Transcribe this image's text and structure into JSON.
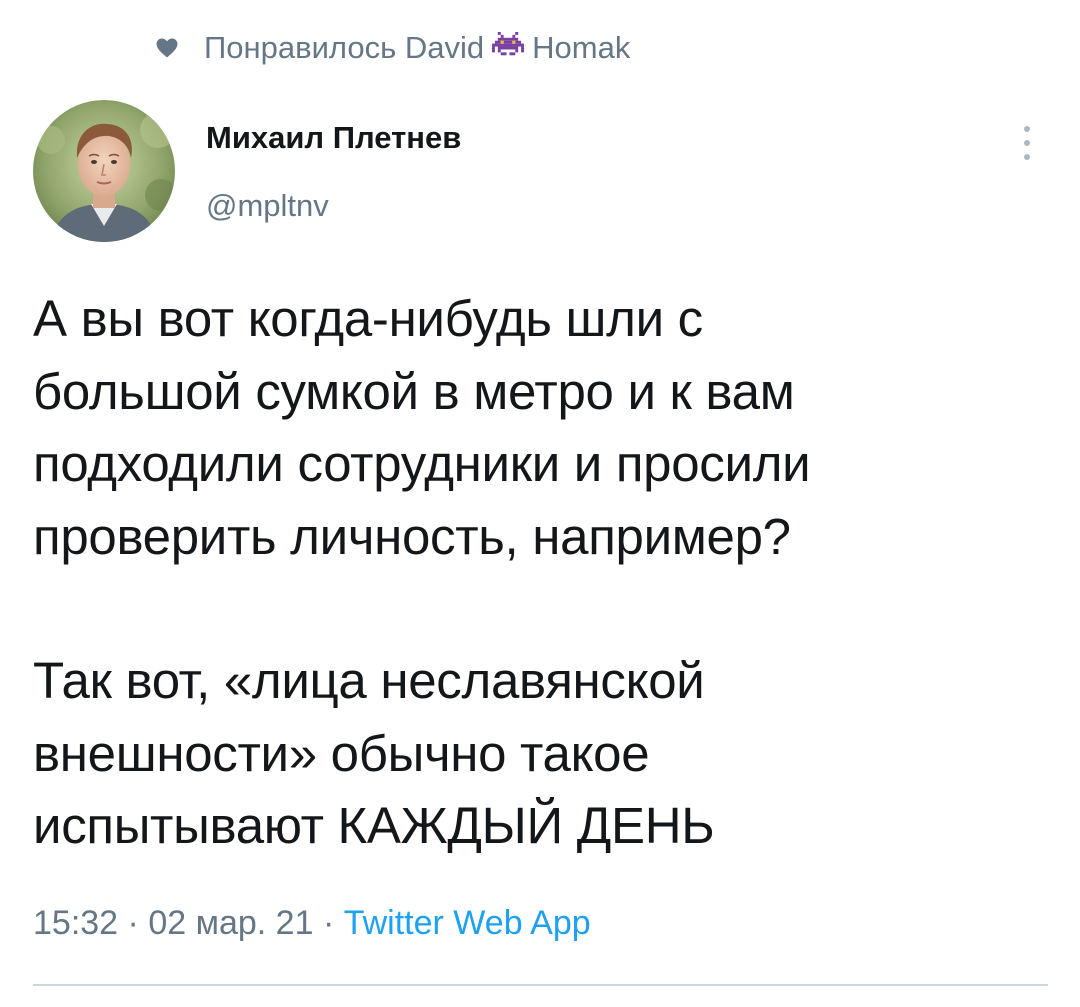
{
  "social_context": {
    "prefix": "Понравилось",
    "user1": "David",
    "user2": "Homak",
    "icons": [
      "heart-icon",
      "space-invader-icon"
    ]
  },
  "author": {
    "display_name": "Михаил Плетнев",
    "handle": "@mpltnv",
    "avatar_icon": "user-avatar"
  },
  "tweet": {
    "paragraph1": "А вы вот когда-нибудь шли с\nбольшой сумкой в метро и к вам\nподходили сотрудники и просили\nпроверить личность, например?",
    "paragraph2": "Так вот, «лица неславянской\nвнешности» обычно такое\nиспытывают КАЖДЫЙ ДЕНЬ"
  },
  "meta": {
    "time": "15:32",
    "separator": "·",
    "date": "02 мар. 21",
    "source": "Twitter Web App"
  },
  "colors": {
    "text_primary": "#14171a",
    "text_secondary": "#657786",
    "link": "#1da1f2",
    "divider": "#ccd6dd"
  }
}
